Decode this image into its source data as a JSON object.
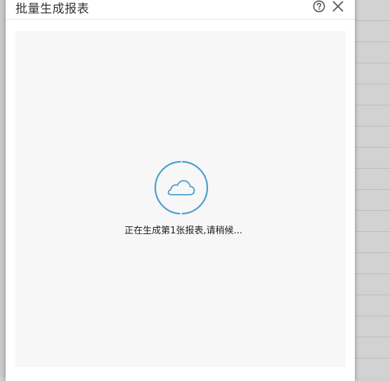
{
  "dialog": {
    "title": "批量生成报表",
    "help_icon": "help-circle-icon",
    "close_icon": "close-icon"
  },
  "loading": {
    "icon": "cloud-icon",
    "message": "正在生成第1张报表,请稍候..."
  },
  "colors": {
    "accent": "#4a9fd0",
    "body_bg": "#f7f7f7",
    "backdrop": "#d0d0d0"
  }
}
